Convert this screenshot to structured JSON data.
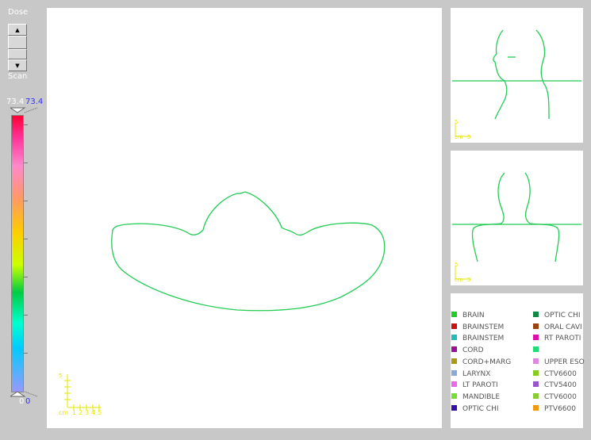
{
  "controls": {
    "dose_label": "Dose",
    "scan_label": "Scan",
    "up_glyph": "▲",
    "down_glyph": "▼"
  },
  "scale": {
    "max_left": "73.4",
    "max_right": "73.4",
    "min_left": "0",
    "min_right": "0"
  },
  "ruler": {
    "unit": "cm",
    "ticks": [
      "1",
      "2",
      "3",
      "4",
      "5"
    ]
  },
  "mini_ruler": {
    "unit": "cm",
    "tick": "5"
  },
  "colors": {
    "contour": "#22cc55",
    "ruler": "#e6e600"
  },
  "legend": {
    "left": [
      {
        "label": "BRAIN",
        "color": "#22cc22"
      },
      {
        "label": "BRAINSTEM",
        "color": "#cc1111"
      },
      {
        "label": "BRAINSTEM",
        "color": "#22bbbb"
      },
      {
        "label": "CORD",
        "color": "#991199"
      },
      {
        "label": "CORD+MARG",
        "color": "#aa9911"
      },
      {
        "label": "LARYNX",
        "color": "#88aadd"
      },
      {
        "label": "LT PAROTI",
        "color": "#ee66ee"
      },
      {
        "label": "MANDIBLE",
        "color": "#77dd33"
      },
      {
        "label": "OPTIC CHI",
        "color": "#3311aa"
      }
    ],
    "right": [
      {
        "label": "OPTIC CHI",
        "color": "#118844"
      },
      {
        "label": "ORAL CAVI",
        "color": "#994411"
      },
      {
        "label": "RT PAROTI",
        "color": "#dd11aa"
      },
      {
        "label": "",
        "color": "#22dd77"
      },
      {
        "label": "UPPER ESO",
        "color": "#dd88dd"
      },
      {
        "label": "CTV6600",
        "color": "#88cc22"
      },
      {
        "label": "CTV5400",
        "color": "#9955cc"
      },
      {
        "label": "CTV6000",
        "color": "#88cc33"
      },
      {
        "label": "PTV6600",
        "color": "#ee9911"
      }
    ]
  }
}
